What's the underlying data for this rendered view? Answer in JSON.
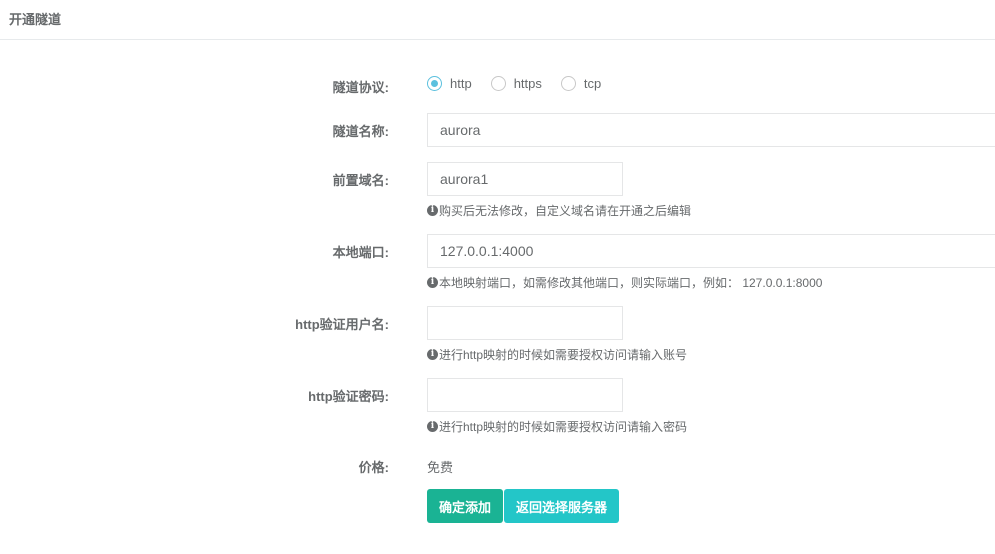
{
  "header": {
    "title": "开通隧道"
  },
  "form": {
    "protocol": {
      "label": "隧道协议:",
      "options": [
        "http",
        "https",
        "tcp"
      ],
      "selected": "http"
    },
    "tunnel_name": {
      "label": "隧道名称:",
      "value": "aurora"
    },
    "prefix_domain": {
      "label": "前置域名:",
      "value": "aurora1",
      "help": "购买后无法修改，自定义域名请在开通之后编辑"
    },
    "local_port": {
      "label": "本地端口:",
      "value": "127.0.0.1:4000",
      "help": "本地映射端口，如需修改其他端口，则实际端口，例如： 127.0.0.1:8000"
    },
    "http_user": {
      "label": "http验证用户名:",
      "value": "",
      "help": "进行http映射的时候如需要授权访问请输入账号"
    },
    "http_password": {
      "label": "http验证密码:",
      "value": "",
      "help": "进行http映射的时候如需要授权访问请输入密码"
    },
    "price": {
      "label": "价格:",
      "value": "免费"
    }
  },
  "buttons": {
    "confirm": "确定添加",
    "back": "返回选择服务器"
  },
  "info_icon_glyph": "❶"
}
